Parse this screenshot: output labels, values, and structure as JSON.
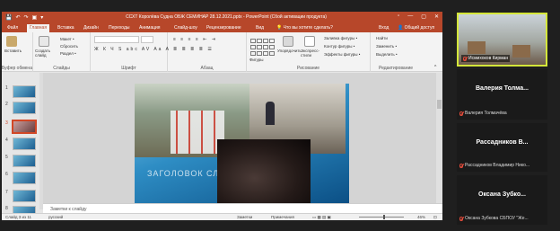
{
  "window": {
    "title": "ССХТ Королёва Судна ОБЖ СЕМИНАР 28.12.2021.pptx - PowerPoint (Сбой активации продукта)",
    "quick_access": [
      "💾",
      "↶",
      "↷",
      "▣",
      "▾"
    ],
    "controls": [
      "▫",
      "—",
      "▢",
      "✕"
    ]
  },
  "tabs": [
    "Файл",
    "Главная",
    "Вставка",
    "Дизайн",
    "Переходы",
    "Анимация",
    "Слайд-шоу",
    "Рецензирование",
    "Вид"
  ],
  "active_tab": "Главная",
  "tell_me": "Что вы хотите сделать?",
  "signin": "Вход",
  "share": "Общий доступ",
  "ribbon": {
    "groups": [
      "Буфер обмена",
      "Слайды",
      "Шрифт",
      "Абзац",
      "Рисование",
      "Редактирование"
    ],
    "clipboard": {
      "paste": "Вставить",
      "cut": "Макет •",
      "copy": "Восстановить",
      "format": "Раздел •"
    },
    "slides": {
      "new_slide": "Создать слайд",
      "layout": "Макет •",
      "reset": "Сбросить",
      "section": "Раздел •"
    },
    "font": {
      "font_name": "",
      "font_size": "",
      "format_row": "Ж К Ч S abc AV Aa A"
    },
    "drawing": {
      "arrange": "Упорядочить",
      "quick_styles": "Экспресс-стили",
      "fill": "Заливка фигуры •",
      "outline": "Контур фигуры •",
      "effects": "Эффекты фигуры •",
      "shapes": "Фигуры"
    },
    "editing": {
      "find": "Найти",
      "replace": "Заменить •",
      "select": "Выделить •"
    }
  },
  "thumbnails": [
    "1",
    "2",
    "3",
    "4",
    "5",
    "6",
    "7",
    "8"
  ],
  "selected_thumbnail": "3",
  "slide": {
    "title_text": "ЗАГОЛОВОК СЛАЙДА"
  },
  "notes_placeholder": "Заметки к слайду",
  "status": {
    "slide_of": "Слайд 3 из 11",
    "language": "русский",
    "notes": "Заметки",
    "comments": "Примечания",
    "zoom": "46%"
  },
  "participants": [
    {
      "tile_name": "",
      "full_name": "Исмихоков Кирман",
      "video": true
    },
    {
      "tile_name": "Валерия Толма...",
      "full_name": "Валерия Толмачёва",
      "video": false
    },
    {
      "tile_name": "Рассадников В...",
      "full_name": "Рассадников Владимир Нико...",
      "video": false
    },
    {
      "tile_name": "Оксана Зубко...",
      "full_name": "Оксана Зубкова СБПОУ \"Же...",
      "video": false
    }
  ],
  "colors": {
    "ppt_accent": "#b7472a",
    "active_speaker_border": "#d4e63a",
    "muted_icon": "#e24b3b"
  }
}
